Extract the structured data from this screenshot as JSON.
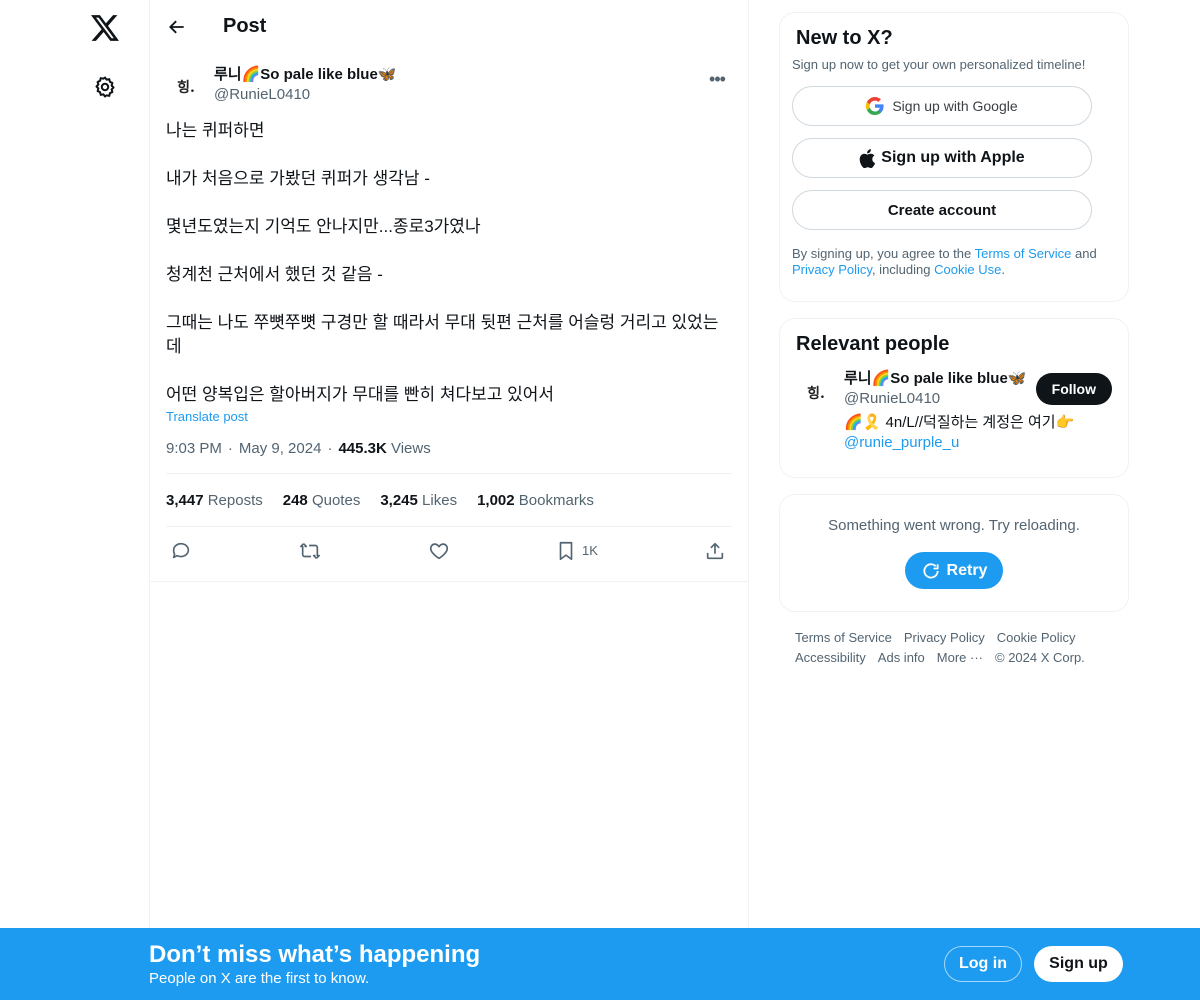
{
  "colors": {
    "accent": "#1d9bf0",
    "text": "#0f1419",
    "muted": "#536471",
    "border": "#eff3f4"
  },
  "nav": {
    "logo_icon": "x-logo-icon",
    "settings_icon": "gear-icon"
  },
  "header": {
    "title": "Post",
    "back_icon": "arrow-left-icon"
  },
  "post": {
    "author": {
      "display_name": "루니🌈So pale like blue🦋",
      "handle": "@RunieL0410",
      "avatar_text": "힝."
    },
    "paragraphs": [
      "나는 퀴퍼하면",
      "내가 처음으로 가봤던 퀴퍼가 생각남 -",
      "몇년도였는지 기억도 안나지만...종로3가였나",
      "청계천 근처에서 했던 것 같음 -",
      "그때는 나도 쭈뼛쭈뼛 구경만 할 때라서 무대 뒷편 근처를 어슬렁 거리고 있었는데",
      "어떤 양복입은 할아버지가 무대를 빤히 쳐다보고 있어서"
    ],
    "translate_label": "Translate post",
    "time": "9:03 PM",
    "date": "May 9, 2024",
    "views_count": "445.3K",
    "views_label": "Views",
    "stats": {
      "reposts_count": "3,447",
      "reposts_label": "Reposts",
      "quotes_count": "248",
      "quotes_label": "Quotes",
      "likes_count": "3,245",
      "likes_label": "Likes",
      "bookmarks_count": "1,002",
      "bookmarks_label": "Bookmarks"
    },
    "actions": {
      "reply_icon": "reply-icon",
      "repost_icon": "repost-icon",
      "like_icon": "heart-icon",
      "bookmark_icon": "bookmark-icon",
      "bookmark_count": "1K",
      "share_icon": "share-icon"
    }
  },
  "signup_card": {
    "title": "New to X?",
    "subtitle": "Sign up now to get your own personalized timeline!",
    "google_label": "Sign up with Google",
    "apple_label": "Sign up with Apple",
    "create_label": "Create account",
    "legal_prefix": "By signing up, you agree to the ",
    "terms_label": "Terms of Service",
    "legal_and": " and ",
    "privacy_label": "Privacy Policy",
    "legal_including": ", including ",
    "cookie_label": "Cookie Use",
    "legal_end": "."
  },
  "relevant_people": {
    "title": "Relevant people",
    "person": {
      "display_name": "루니🌈So pale like blue🦋",
      "handle": "@RunieL0410",
      "avatar_text": "힝.",
      "bio": "🌈🎗️ 4n/L//덕질하는 계정은 여기👉",
      "bio_mention": "@runie_purple_u",
      "follow_label": "Follow"
    }
  },
  "error_card": {
    "message": "Something went wrong. Try reloading.",
    "retry_label": "Retry"
  },
  "footer": {
    "terms": "Terms of Service",
    "privacy": "Privacy Policy",
    "cookie": "Cookie Policy",
    "accessibility": "Accessibility",
    "ads": "Ads info",
    "more": "More ···",
    "copyright": "© 2024 X Corp."
  },
  "banner": {
    "title": "Don’t miss what’s happening",
    "subtitle": "People on X are the first to know.",
    "login_label": "Log in",
    "signup_label": "Sign up"
  }
}
